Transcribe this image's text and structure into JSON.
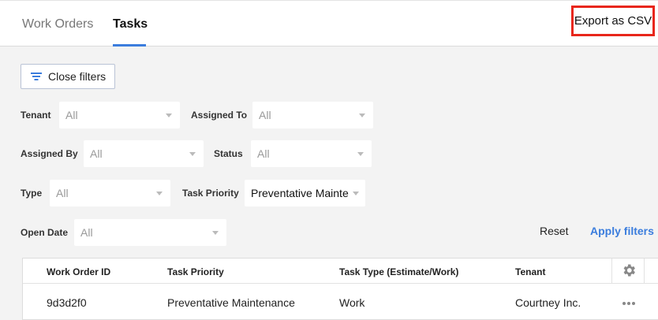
{
  "header": {
    "tabs": [
      {
        "label": "Work Orders",
        "active": false
      },
      {
        "label": "Tasks",
        "active": true
      }
    ],
    "export_label": "Export as CSV"
  },
  "filters": {
    "close_label": "Close filters",
    "tenant": {
      "label": "Tenant",
      "value": "All"
    },
    "assigned_to": {
      "label": "Assigned To",
      "value": "All"
    },
    "assigned_by": {
      "label": "Assigned By",
      "value": "All"
    },
    "status": {
      "label": "Status",
      "value": "All"
    },
    "type": {
      "label": "Type",
      "value": "All"
    },
    "task_priority": {
      "label": "Task Priority",
      "value": "Preventative Mainte"
    },
    "open_date": {
      "label": "Open Date",
      "value": "All"
    },
    "reset_label": "Reset",
    "apply_label": "Apply filters"
  },
  "table": {
    "columns": [
      "Work Order ID",
      "Task Priority",
      "Task Type (Estimate/Work)",
      "Tenant"
    ],
    "rows": [
      {
        "work_order_id": "9d3d2f0",
        "task_priority": "Preventative Maintenance",
        "task_type": "Work",
        "tenant": "Courtney Inc."
      }
    ]
  },
  "colors": {
    "accent": "#3b7ddd",
    "highlight": "#e8261b"
  },
  "icons": {
    "filter": "filter-lines-icon",
    "settings": "gear-icon",
    "row_menu": "more-horizontal-icon"
  }
}
